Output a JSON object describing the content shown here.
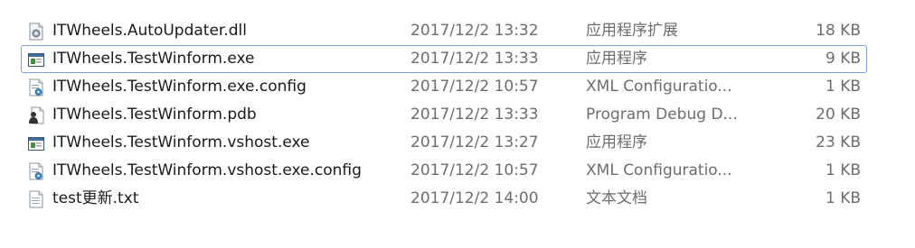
{
  "files": [
    {
      "name": "ITWheels.AutoUpdater.dll",
      "modified": "2017/12/2 13:32",
      "type": "应用程序扩展",
      "size": "18 KB",
      "icon": "dll-gear-icon"
    },
    {
      "name": "ITWheels.TestWinform.exe",
      "modified": "2017/12/2 13:33",
      "type": "应用程序",
      "size": "9 KB",
      "icon": "exe-window-icon",
      "selected": true
    },
    {
      "name": "ITWheels.TestWinform.exe.config",
      "modified": "2017/12/2 10:57",
      "type": "XML Configuratio...",
      "size": "1 KB",
      "icon": "config-file-icon"
    },
    {
      "name": "ITWheels.TestWinform.pdb",
      "modified": "2017/12/2 13:33",
      "type": "Program Debug D...",
      "size": "20 KB",
      "icon": "pdb-file-icon"
    },
    {
      "name": "ITWheels.TestWinform.vshost.exe",
      "modified": "2017/12/2 13:27",
      "type": "应用程序",
      "size": "23 KB",
      "icon": "exe-window-icon"
    },
    {
      "name": "ITWheels.TestWinform.vshost.exe.config",
      "modified": "2017/12/2 10:57",
      "type": "XML Configuratio...",
      "size": "1 KB",
      "icon": "config-file-icon"
    },
    {
      "name": "test更新.txt",
      "modified": "2017/12/2 14:00",
      "type": "文本文档",
      "size": "1 KB",
      "icon": "text-file-icon"
    }
  ]
}
